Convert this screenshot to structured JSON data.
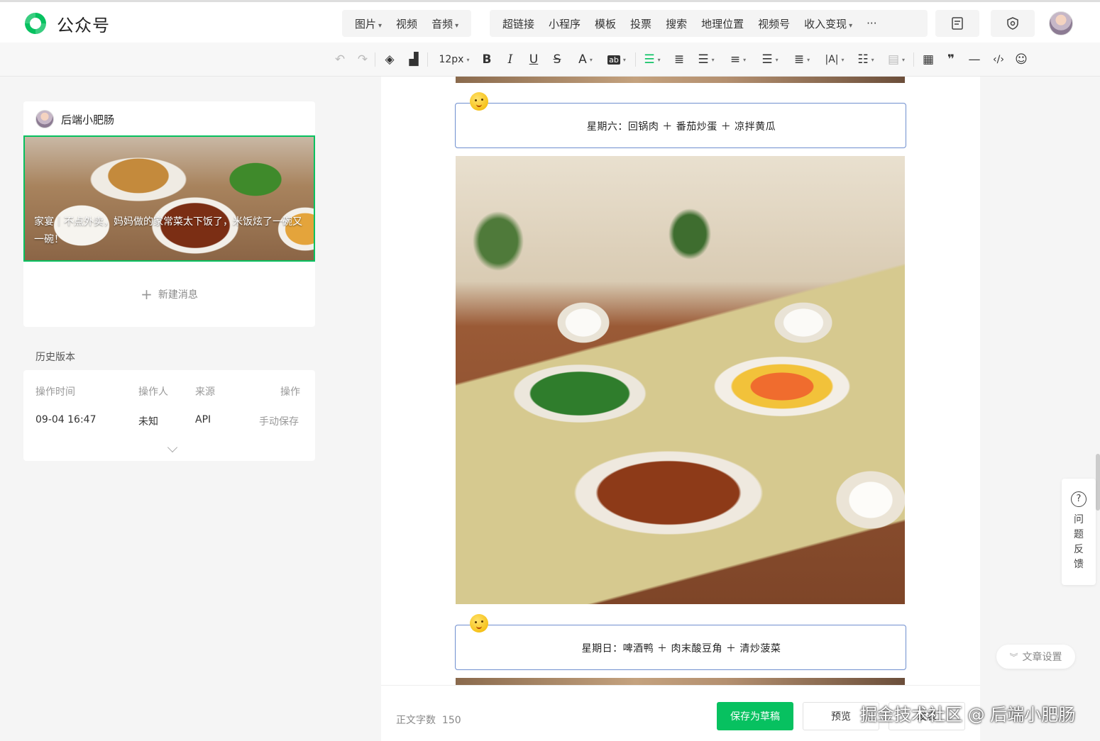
{
  "app": {
    "title": "公众号"
  },
  "top_menu": {
    "group1": [
      {
        "label": "图片",
        "dropdown": true
      },
      {
        "label": "视频",
        "dropdown": false
      },
      {
        "label": "音频",
        "dropdown": true
      }
    ],
    "group2": [
      {
        "label": "超链接",
        "dropdown": false
      },
      {
        "label": "小程序",
        "dropdown": false
      },
      {
        "label": "模板",
        "dropdown": false
      },
      {
        "label": "投票",
        "dropdown": false
      },
      {
        "label": "搜索",
        "dropdown": false
      },
      {
        "label": "地理位置",
        "dropdown": false
      },
      {
        "label": "视频号",
        "dropdown": false
      },
      {
        "label": "收入变现",
        "dropdown": true
      },
      {
        "label": "···",
        "dropdown": false
      }
    ]
  },
  "format_toolbar": {
    "font_size": "12px",
    "icons": [
      "undo-icon",
      "redo-icon",
      "clear-format-icon",
      "format-painter-icon",
      "bold-icon",
      "italic-icon",
      "underline-icon",
      "strikethrough-icon",
      "font-color-icon",
      "background-color-icon",
      "align-center-icon",
      "indent-icon",
      "align-justify-icon",
      "line-height-icon",
      "paragraph-spacing-icon",
      "letter-spacing-icon",
      "list-icon",
      "float-icon",
      "table-icon",
      "quote-icon",
      "divider-icon",
      "code-icon",
      "emoji-icon"
    ]
  },
  "account": {
    "name": "后端小肥肠",
    "cover_title": "家宴｜不点外卖，妈妈做的家常菜太下饭了，米饭炫了一碗又一碗！",
    "new_message": "新建消息"
  },
  "history": {
    "title": "历史版本",
    "columns": [
      "操作时间",
      "操作人",
      "来源",
      "操作"
    ],
    "rows": [
      {
        "time": "09-04 16:47",
        "operator": "未知",
        "source": "API",
        "action": "手动保存"
      }
    ]
  },
  "editor": {
    "day6": "星期六：回锅肉 ＋ 番茄炒蛋 ＋ 凉拌黄瓜",
    "day7": "星期日：啤酒鸭 ＋ 肉末酸豆角 ＋ 清炒菠菜"
  },
  "bottom": {
    "word_count_label": "正文字数",
    "word_count": "150",
    "save_draft": "保存为草稿",
    "preview": "预览",
    "publish": "发表"
  },
  "side": {
    "feedback": "问题反馈",
    "article_settings": "文章设置"
  },
  "watermark": "掘金技术社区 @ 后端小肥肠",
  "colors": {
    "accent": "#07c160",
    "box_border": "#6f8fcf"
  }
}
